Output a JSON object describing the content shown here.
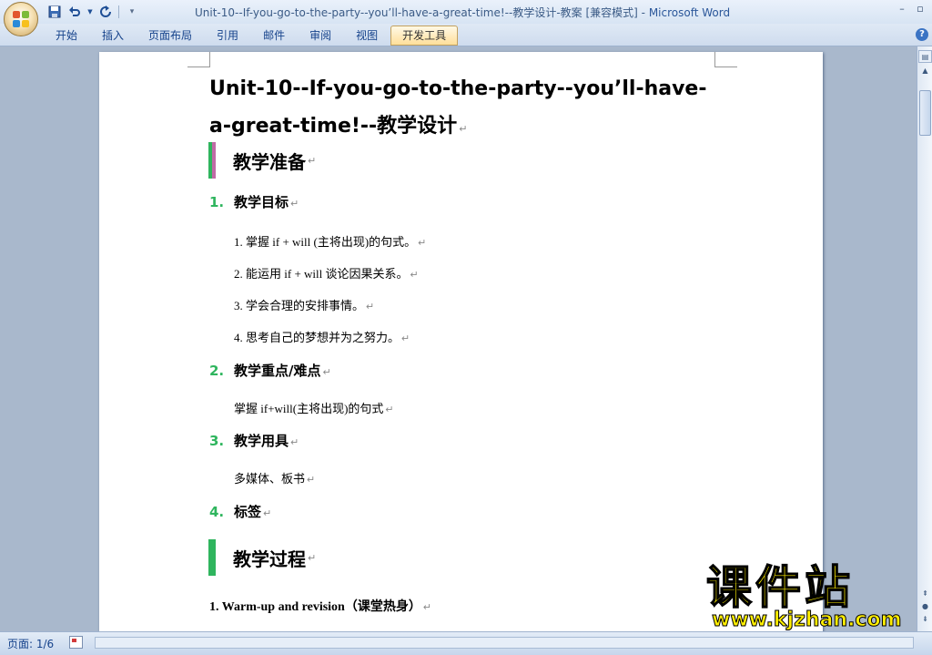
{
  "window": {
    "title": "Unit-10--If-you-go-to-the-party--you’ll-have-a-great-time!--教学设计-教案 [兼容模式]",
    "app_separator": " - ",
    "app_name": "Microsoft Word"
  },
  "ribbon": {
    "tabs": [
      {
        "label": "开始"
      },
      {
        "label": "插入"
      },
      {
        "label": "页面布局"
      },
      {
        "label": "引用"
      },
      {
        "label": "邮件"
      },
      {
        "label": "审阅"
      },
      {
        "label": "视图"
      },
      {
        "label": "开发工具",
        "active": true
      }
    ]
  },
  "document": {
    "title": "Unit-10--If-you-go-to-the-party--you’ll-have-a-great-time!--教学设计",
    "sections": {
      "prep": "教学准备",
      "process": "教学过程"
    },
    "items": {
      "goal": {
        "num": "1.",
        "label": "教学目标"
      },
      "key": {
        "num": "2.",
        "label": "教学重点/难点"
      },
      "tools": {
        "num": "3.",
        "label": "教学用具"
      },
      "tags": {
        "num": "4.",
        "label": "标签"
      }
    },
    "goal_lines": [
      "1. 掌握 if + will (主将出现)的句式。",
      "2. 能运用 if + will 谈论因果关系。",
      "3. 学会合理的安排事情。",
      "4. 思考自己的梦想并为之努力。"
    ],
    "key_line": "掌握 if+will(主将出现)的句式",
    "tools_line": "多媒体、板书",
    "process_step1": "1. Warm-up and revision（课堂热身）",
    "paragraph_mark": "↵"
  },
  "statusbar": {
    "page_indicator": "页面: 1/6"
  },
  "watermark": {
    "chinese": "课件站",
    "url": "www.kjzhan.com"
  },
  "colors": {
    "accent_green": "#2fb55e",
    "accent_pink": "#c06aa6",
    "ribbon_text": "#15428b",
    "watermark_yellow": "#ffee00"
  },
  "icons": {
    "save": "save-icon",
    "undo": "undo-icon",
    "redo": "redo-icon",
    "customize": "customize-qat-icon",
    "minimize": "minimize-icon",
    "restore": "restore-icon",
    "help": "help-icon"
  }
}
